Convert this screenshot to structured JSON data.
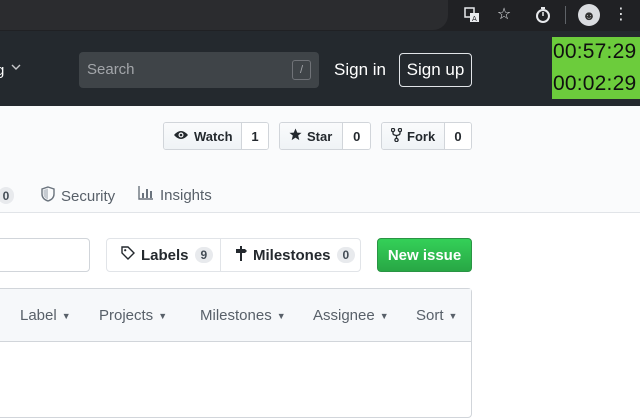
{
  "chrome": {
    "icons": [
      "translate-icon",
      "star-icon",
      "stopwatch-icon",
      "avatar-icon",
      "more-vert-icon"
    ]
  },
  "header": {
    "org_fragment": "g",
    "search_placeholder": "Search",
    "search_shortcut": "/",
    "signin_label": "Sign in",
    "signup_label": "Sign up"
  },
  "timer": {
    "line1": "00:57:29",
    "line2": "00:02:29",
    "background": "#6ccc3c"
  },
  "repo_actions": {
    "watch": {
      "label": "Watch",
      "count": "1"
    },
    "star": {
      "label": "Star",
      "count": "0"
    },
    "fork": {
      "label": "Fork",
      "count": "0"
    }
  },
  "tabs": {
    "partial_counter": "0",
    "security": "Security",
    "insights": "Insights"
  },
  "subnav": {
    "labels": {
      "label": "Labels",
      "count": "9"
    },
    "milestones": {
      "label": "Milestones",
      "count": "0"
    },
    "new_issue": "New issue"
  },
  "table_filters": {
    "label": "Label",
    "projects": "Projects",
    "milestones": "Milestones",
    "assignee": "Assignee",
    "sort": "Sort"
  },
  "colors": {
    "header_bg": "#24292e",
    "accent_green": "#28a745",
    "chrome_bg": "#202124"
  }
}
